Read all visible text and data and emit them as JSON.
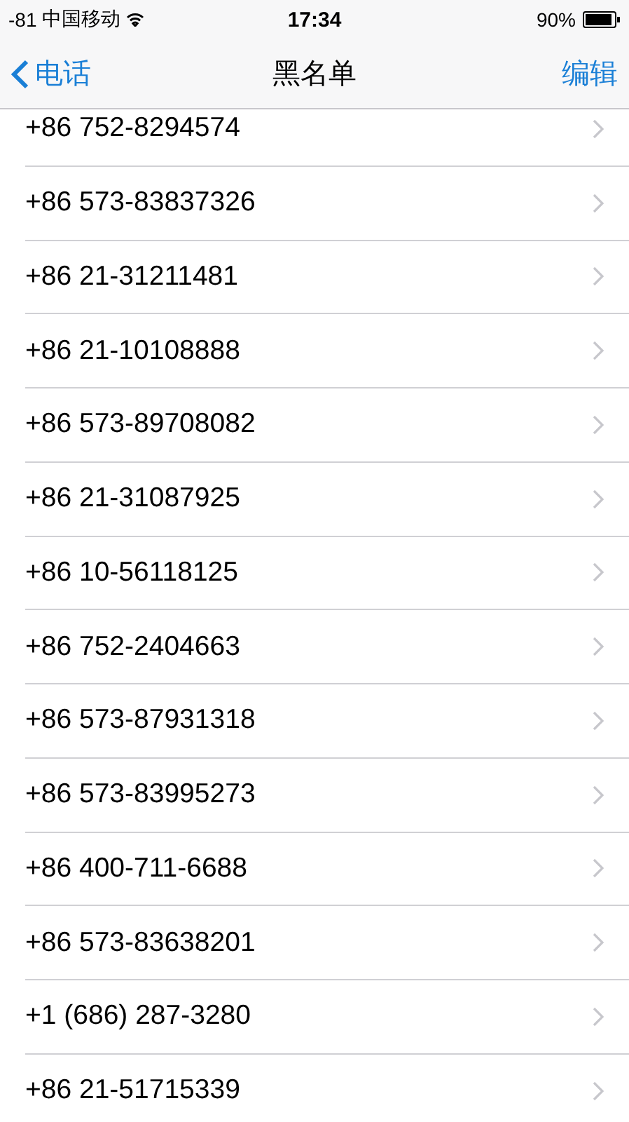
{
  "status_bar": {
    "signal": "-81",
    "carrier": "中国移动",
    "time": "17:34",
    "battery": "90%"
  },
  "nav": {
    "back": "电话",
    "title": "黑名单",
    "action": "编辑"
  },
  "numbers": [
    "+86 752-8294574",
    "+86 573-83837326",
    "+86 21-31211481",
    "+86 21-10108888",
    "+86 573-89708082",
    "+86 21-31087925",
    "+86 10-56118125",
    "+86 752-2404663",
    "+86 573-87931318",
    "+86 573-83995273",
    "+86 400-711-6688",
    "+86 573-83638201",
    "+1 (686) 287-3280",
    "+86 21-51715339"
  ]
}
